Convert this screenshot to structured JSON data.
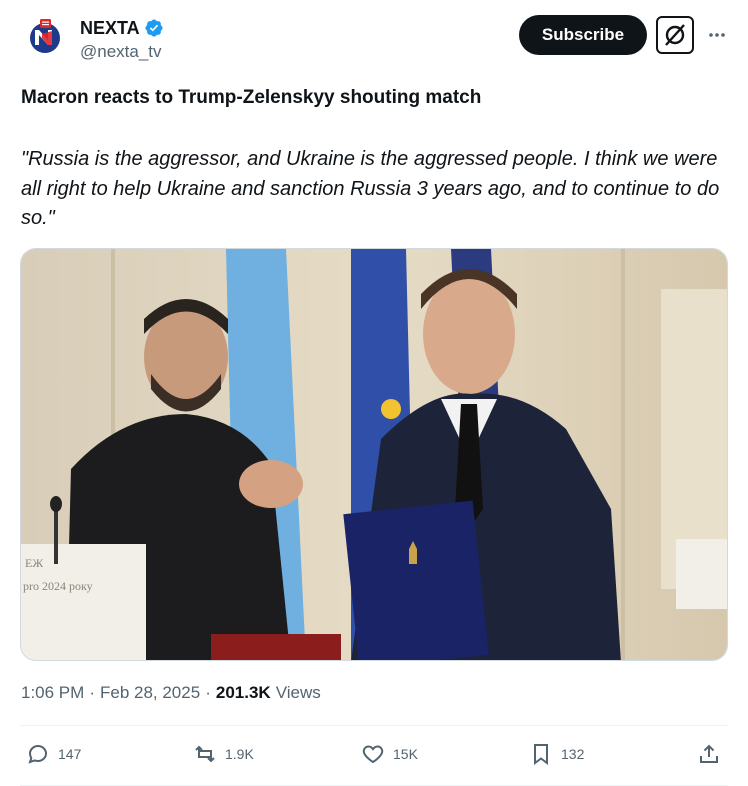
{
  "author": {
    "name": "NEXTA",
    "handle": "@nexta_tv",
    "avatar_icon": "nexta-logo",
    "verified_color": "#1d9bf0"
  },
  "header": {
    "subscribe_label": "Subscribe",
    "grok_icon": "grok-icon",
    "more_icon": "more-icon"
  },
  "tweet": {
    "headline": "Macron reacts to Trump-Zelenskyy shouting match",
    "quote": "\"Russia is the aggressor, and Ukraine is the aggressed people. I think we were all right to help Ukraine and sanction Russia 3 years ago, and to continue to do so.\"",
    "image_placard_line1": "ЕЖ",
    "image_placard_line2": "pro 2024 року"
  },
  "meta": {
    "time": "1:06 PM",
    "date": "Feb 28, 2025",
    "views_count": "201.3K",
    "views_label": "Views",
    "dot": "·"
  },
  "actions": {
    "replies": "147",
    "reposts": "1.9K",
    "likes": "15K",
    "bookmarks": "132"
  },
  "colors": {
    "text": "#0f1419",
    "secondary": "#536471",
    "brand_red": "#e0252b",
    "brand_blue": "#1e3a8a"
  }
}
